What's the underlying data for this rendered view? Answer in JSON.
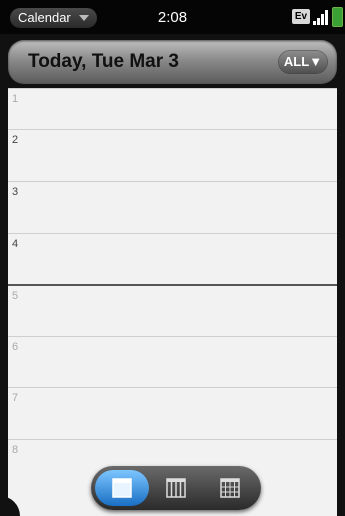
{
  "statusbar": {
    "app_name": "Calendar",
    "time": "2:08",
    "network": "Ev"
  },
  "header": {
    "title": "Today, Tue Mar 3",
    "filter_label": "ALL▼"
  },
  "hours": [
    "1",
    "2",
    "3",
    "4",
    "5",
    "6",
    "7",
    "8"
  ],
  "view_switcher": {
    "active": "day",
    "options": [
      "day-view-icon",
      "week-view-icon",
      "month-view-icon"
    ]
  },
  "colors": {
    "accent": "#1a6fc4",
    "battery": "#3aa035"
  }
}
